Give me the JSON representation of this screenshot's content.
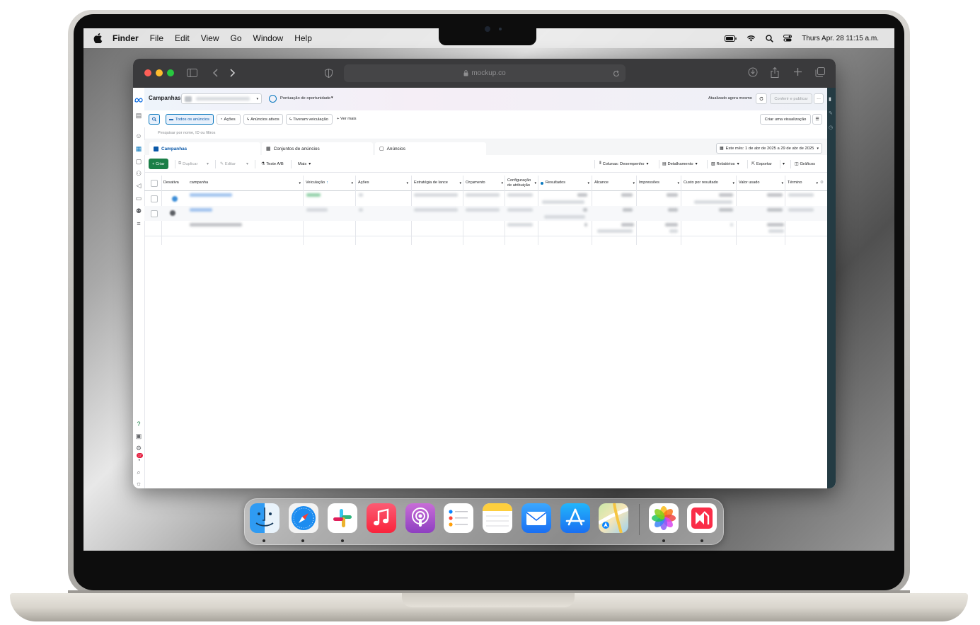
{
  "menubar": {
    "app_name": "Finder",
    "items": [
      "File",
      "Edit",
      "View",
      "Go",
      "Window",
      "Help"
    ],
    "datetime": "Thurs Apr. 28  11:15 a.m."
  },
  "browser": {
    "url": "mockup.co"
  },
  "header": {
    "title": "Campanhas",
    "account_label": "",
    "opportunity_label": "Pontuação de oportunidade",
    "opportunity_score": "",
    "updated_text": "Atualizado agora mesmo",
    "review_button": "Conferir e publicar",
    "more_button": "···"
  },
  "filters": {
    "all_ads": "Todos os anúncios",
    "actions": "Ações",
    "active_ads": "Anúncios ativos",
    "had_delivery": "Tiveram veiculação",
    "see_more": "+ Ver mais",
    "create_view": "Criar uma visualização",
    "search_placeholder": "Pesquisar por nome, ID ou filtros"
  },
  "tabs": {
    "campaigns": "Campanhas",
    "adsets": "Conjuntos de anúncios",
    "ads": "Anúncios",
    "date_range": "Este mês: 1 de abr de 2025 a 29 de abr de 2025"
  },
  "toolbar": {
    "create": "+ Criar",
    "duplicate": "Duplicar",
    "edit": "Editar",
    "ab_test": "Teste A/B",
    "more": "Mais",
    "columns": "Colunas: Desempenho",
    "breakdown": "Detalhamento",
    "reports": "Relatórios",
    "export": "Exportar",
    "charts": "Gráficos"
  },
  "table": {
    "headers": {
      "toggle": "Desativa",
      "campaign": "campanha",
      "delivery": "Veiculação",
      "actions": "Ações",
      "bid_strategy": "Estratégia de lance",
      "budget": "Orçamento",
      "attribution": "Configuração de atribuição",
      "results": "Resultados",
      "reach": "Alcance",
      "impressions": "Impressões",
      "cost_per_result": "Custo por resultado",
      "amount_spent": "Valor usado",
      "end": "Término"
    }
  },
  "dock": {
    "apps": [
      "finder-icon",
      "safari-icon",
      "slack-icon",
      "music-icon",
      "podcasts-icon",
      "reminders-icon",
      "notes-icon",
      "mail-icon",
      "app-store-icon",
      "maps-icon",
      "photos-icon",
      "news-icon"
    ]
  },
  "sidebar": {
    "notification_count": "17"
  }
}
